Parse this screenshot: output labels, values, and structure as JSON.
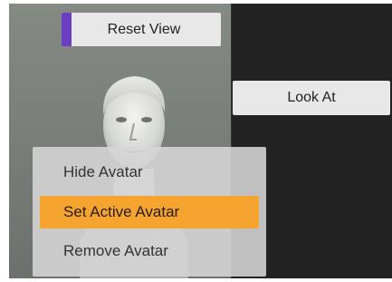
{
  "toolbar": {
    "reset_view_label": "Reset View",
    "look_at_label": "Look At"
  },
  "context_menu": {
    "items": [
      {
        "label": "Hide Avatar",
        "selected": false
      },
      {
        "label": "Set Active Avatar",
        "selected": true
      },
      {
        "label": "Remove Avatar",
        "selected": false
      }
    ]
  },
  "colors": {
    "viewport_background": "#222222",
    "avatar_panel": "#7f847f",
    "reset_accent": "#6b3fc4",
    "selected_item": "#f5a52f",
    "menu_background": "#d6d6d6"
  },
  "icons": {
    "avatar_preview": "avatar-bust-image"
  }
}
